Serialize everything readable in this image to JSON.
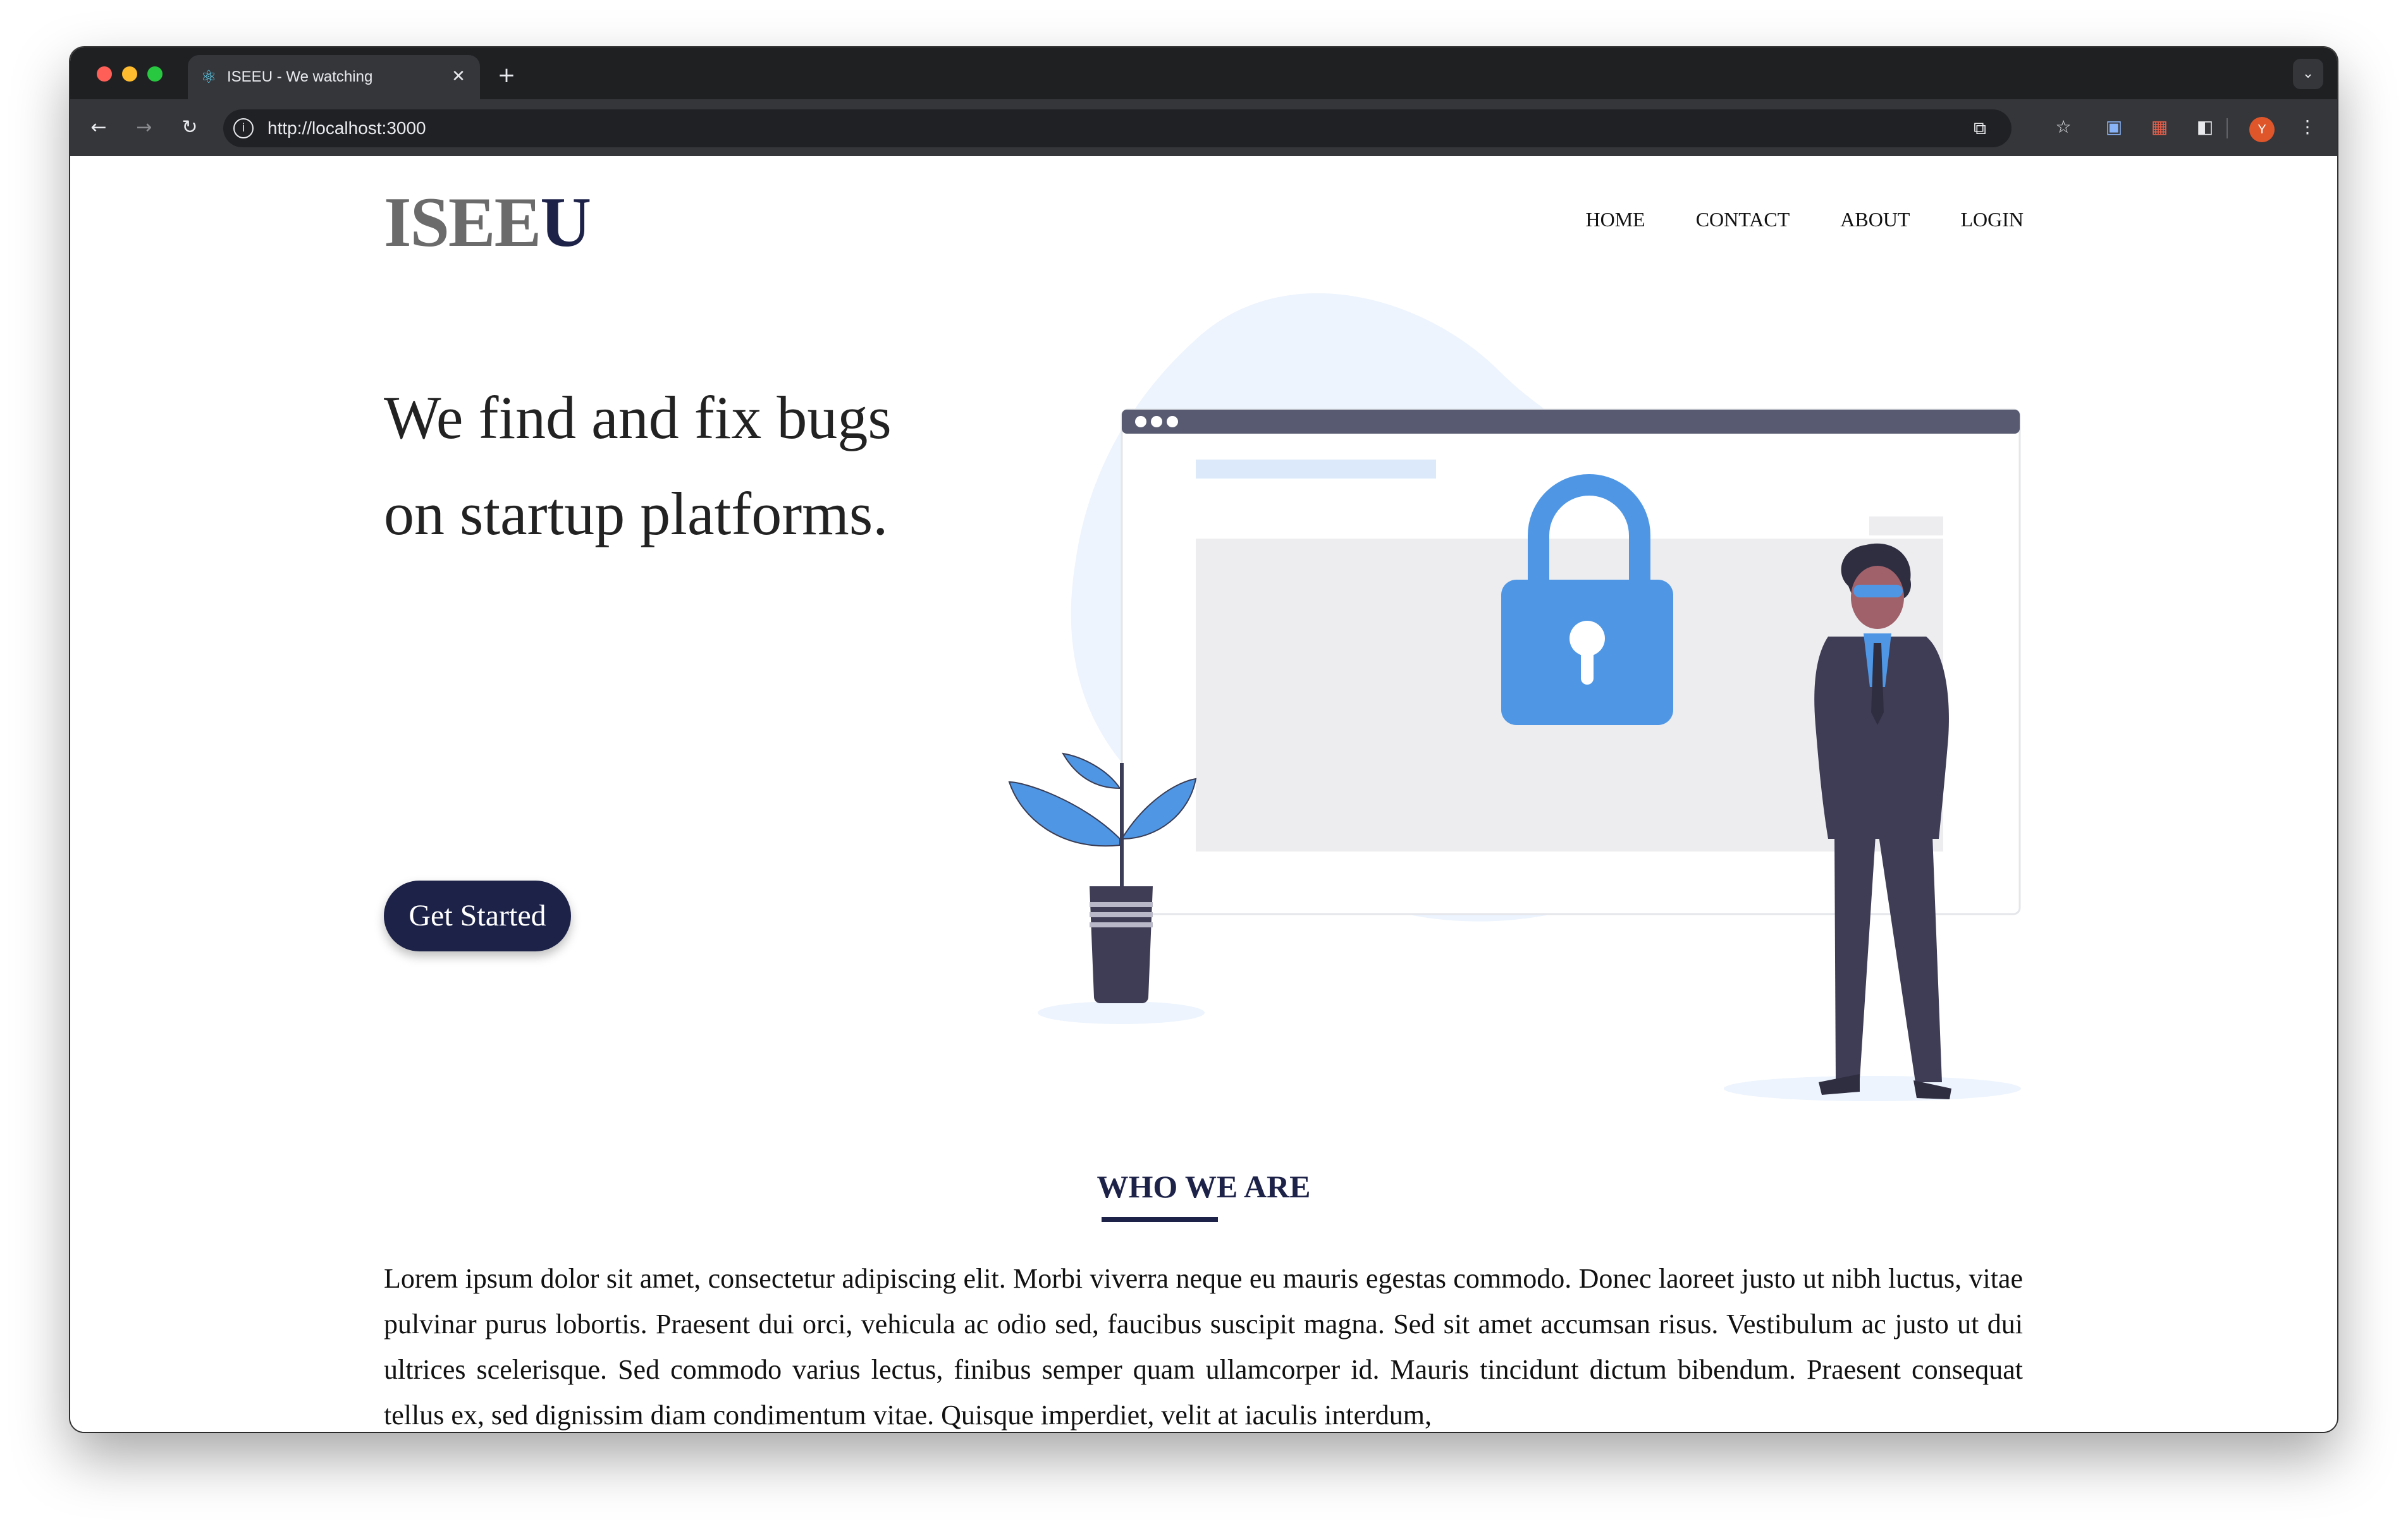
{
  "browser": {
    "tab_title": "ISEEU - We watching",
    "tab_close": "✕",
    "new_tab": "+",
    "tab_menu": "⌄",
    "url": "http://localhost:3000",
    "icons": [
      "back-icon",
      "forward-icon",
      "reload-icon",
      "site-info-icon",
      "cast-icon",
      "bookmark-star-icon",
      "extension-icon",
      "puzzle-icon",
      "profile-avatar"
    ],
    "avatar_letter": "Y"
  },
  "site": {
    "logo_main": "ISEE",
    "logo_accent": "U",
    "nav": [
      "HOME",
      "CONTACT",
      "ABOUT",
      "LOGIN"
    ],
    "hero_line1": "We find and fix bugs",
    "hero_line2": "on startup platforms.",
    "cta": "Get Started",
    "section_title": "WHO WE ARE",
    "body": "Lorem ipsum dolor sit amet, consectetur adipiscing elit. Morbi viverra neque eu mauris egestas commodo. Donec laoreet justo ut nibh luctus, vitae pulvinar purus lobortis. Praesent dui orci, vehicula ac odio sed, faucibus suscipit magna. Sed sit amet accumsan risus. Vestibulum ac justo ut dui ultrices scelerisque. Sed commodo varius lectus, finibus semper quam ullamcorper id. Mauris tincidunt dictum bibendum. Praesent consequat tellus ex, sed dignissim diam condimentum vitae. Quisque imperdiet, velit at iaculis interdum,"
  },
  "colors": {
    "brand": "#1d2249",
    "logo_gray": "#6b6b6b",
    "accent_blue": "#4f97e5",
    "chrome_dark": "#1f2022"
  }
}
